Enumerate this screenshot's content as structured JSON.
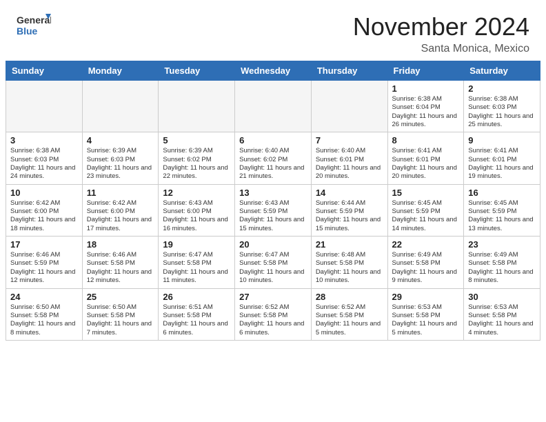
{
  "header": {
    "logo_general": "General",
    "logo_blue": "Blue",
    "month_title": "November 2024",
    "location": "Santa Monica, Mexico"
  },
  "days_of_week": [
    "Sunday",
    "Monday",
    "Tuesday",
    "Wednesday",
    "Thursday",
    "Friday",
    "Saturday"
  ],
  "weeks": [
    [
      {
        "day": "",
        "empty": true
      },
      {
        "day": "",
        "empty": true
      },
      {
        "day": "",
        "empty": true
      },
      {
        "day": "",
        "empty": true
      },
      {
        "day": "",
        "empty": true
      },
      {
        "day": "1",
        "sunrise": "Sunrise: 6:38 AM",
        "sunset": "Sunset: 6:04 PM",
        "daylight": "Daylight: 11 hours and 26 minutes."
      },
      {
        "day": "2",
        "sunrise": "Sunrise: 6:38 AM",
        "sunset": "Sunset: 6:03 PM",
        "daylight": "Daylight: 11 hours and 25 minutes."
      }
    ],
    [
      {
        "day": "3",
        "sunrise": "Sunrise: 6:38 AM",
        "sunset": "Sunset: 6:03 PM",
        "daylight": "Daylight: 11 hours and 24 minutes."
      },
      {
        "day": "4",
        "sunrise": "Sunrise: 6:39 AM",
        "sunset": "Sunset: 6:03 PM",
        "daylight": "Daylight: 11 hours and 23 minutes."
      },
      {
        "day": "5",
        "sunrise": "Sunrise: 6:39 AM",
        "sunset": "Sunset: 6:02 PM",
        "daylight": "Daylight: 11 hours and 22 minutes."
      },
      {
        "day": "6",
        "sunrise": "Sunrise: 6:40 AM",
        "sunset": "Sunset: 6:02 PM",
        "daylight": "Daylight: 11 hours and 21 minutes."
      },
      {
        "day": "7",
        "sunrise": "Sunrise: 6:40 AM",
        "sunset": "Sunset: 6:01 PM",
        "daylight": "Daylight: 11 hours and 20 minutes."
      },
      {
        "day": "8",
        "sunrise": "Sunrise: 6:41 AM",
        "sunset": "Sunset: 6:01 PM",
        "daylight": "Daylight: 11 hours and 20 minutes."
      },
      {
        "day": "9",
        "sunrise": "Sunrise: 6:41 AM",
        "sunset": "Sunset: 6:01 PM",
        "daylight": "Daylight: 11 hours and 19 minutes."
      }
    ],
    [
      {
        "day": "10",
        "sunrise": "Sunrise: 6:42 AM",
        "sunset": "Sunset: 6:00 PM",
        "daylight": "Daylight: 11 hours and 18 minutes."
      },
      {
        "day": "11",
        "sunrise": "Sunrise: 6:42 AM",
        "sunset": "Sunset: 6:00 PM",
        "daylight": "Daylight: 11 hours and 17 minutes."
      },
      {
        "day": "12",
        "sunrise": "Sunrise: 6:43 AM",
        "sunset": "Sunset: 6:00 PM",
        "daylight": "Daylight: 11 hours and 16 minutes."
      },
      {
        "day": "13",
        "sunrise": "Sunrise: 6:43 AM",
        "sunset": "Sunset: 5:59 PM",
        "daylight": "Daylight: 11 hours and 15 minutes."
      },
      {
        "day": "14",
        "sunrise": "Sunrise: 6:44 AM",
        "sunset": "Sunset: 5:59 PM",
        "daylight": "Daylight: 11 hours and 15 minutes."
      },
      {
        "day": "15",
        "sunrise": "Sunrise: 6:45 AM",
        "sunset": "Sunset: 5:59 PM",
        "daylight": "Daylight: 11 hours and 14 minutes."
      },
      {
        "day": "16",
        "sunrise": "Sunrise: 6:45 AM",
        "sunset": "Sunset: 5:59 PM",
        "daylight": "Daylight: 11 hours and 13 minutes."
      }
    ],
    [
      {
        "day": "17",
        "sunrise": "Sunrise: 6:46 AM",
        "sunset": "Sunset: 5:59 PM",
        "daylight": "Daylight: 11 hours and 12 minutes."
      },
      {
        "day": "18",
        "sunrise": "Sunrise: 6:46 AM",
        "sunset": "Sunset: 5:58 PM",
        "daylight": "Daylight: 11 hours and 12 minutes."
      },
      {
        "day": "19",
        "sunrise": "Sunrise: 6:47 AM",
        "sunset": "Sunset: 5:58 PM",
        "daylight": "Daylight: 11 hours and 11 minutes."
      },
      {
        "day": "20",
        "sunrise": "Sunrise: 6:47 AM",
        "sunset": "Sunset: 5:58 PM",
        "daylight": "Daylight: 11 hours and 10 minutes."
      },
      {
        "day": "21",
        "sunrise": "Sunrise: 6:48 AM",
        "sunset": "Sunset: 5:58 PM",
        "daylight": "Daylight: 11 hours and 10 minutes."
      },
      {
        "day": "22",
        "sunrise": "Sunrise: 6:49 AM",
        "sunset": "Sunset: 5:58 PM",
        "daylight": "Daylight: 11 hours and 9 minutes."
      },
      {
        "day": "23",
        "sunrise": "Sunrise: 6:49 AM",
        "sunset": "Sunset: 5:58 PM",
        "daylight": "Daylight: 11 hours and 8 minutes."
      }
    ],
    [
      {
        "day": "24",
        "sunrise": "Sunrise: 6:50 AM",
        "sunset": "Sunset: 5:58 PM",
        "daylight": "Daylight: 11 hours and 8 minutes."
      },
      {
        "day": "25",
        "sunrise": "Sunrise: 6:50 AM",
        "sunset": "Sunset: 5:58 PM",
        "daylight": "Daylight: 11 hours and 7 minutes."
      },
      {
        "day": "26",
        "sunrise": "Sunrise: 6:51 AM",
        "sunset": "Sunset: 5:58 PM",
        "daylight": "Daylight: 11 hours and 6 minutes."
      },
      {
        "day": "27",
        "sunrise": "Sunrise: 6:52 AM",
        "sunset": "Sunset: 5:58 PM",
        "daylight": "Daylight: 11 hours and 6 minutes."
      },
      {
        "day": "28",
        "sunrise": "Sunrise: 6:52 AM",
        "sunset": "Sunset: 5:58 PM",
        "daylight": "Daylight: 11 hours and 5 minutes."
      },
      {
        "day": "29",
        "sunrise": "Sunrise: 6:53 AM",
        "sunset": "Sunset: 5:58 PM",
        "daylight": "Daylight: 11 hours and 5 minutes."
      },
      {
        "day": "30",
        "sunrise": "Sunrise: 6:53 AM",
        "sunset": "Sunset: 5:58 PM",
        "daylight": "Daylight: 11 hours and 4 minutes."
      }
    ]
  ]
}
